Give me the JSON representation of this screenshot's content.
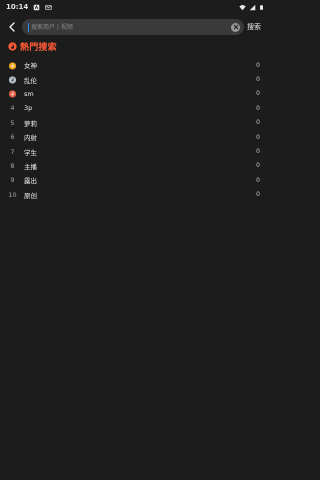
{
  "status_bar": {
    "time": "10:14",
    "icons": [
      "notification-a-icon",
      "mail-icon",
      "wifi-icon",
      "signal-icon",
      "battery-icon"
    ]
  },
  "search": {
    "back_icon": "chevron-left-icon",
    "placeholder": "搜索用户 | 视频",
    "value": "",
    "clear_icon": "clear-icon",
    "action_label": "搜索"
  },
  "hot": {
    "title": "熱門搜索",
    "title_color": "#ff5a36",
    "items": [
      {
        "rank": "1",
        "label": "女神",
        "count": "0",
        "medal": "gold"
      },
      {
        "rank": "2",
        "label": "乱伦",
        "count": "0",
        "medal": "silver"
      },
      {
        "rank": "3",
        "label": "sm",
        "count": "0",
        "medal": "bronze"
      },
      {
        "rank": "4",
        "label": "3p",
        "count": "0"
      },
      {
        "rank": "5",
        "label": "萝莉",
        "count": "0"
      },
      {
        "rank": "6",
        "label": "内射",
        "count": "0"
      },
      {
        "rank": "7",
        "label": "学生",
        "count": "0"
      },
      {
        "rank": "8",
        "label": "主播",
        "count": "0"
      },
      {
        "rank": "9",
        "label": "露出",
        "count": "0"
      },
      {
        "rank": "10",
        "label": "原创",
        "count": "0"
      }
    ]
  }
}
